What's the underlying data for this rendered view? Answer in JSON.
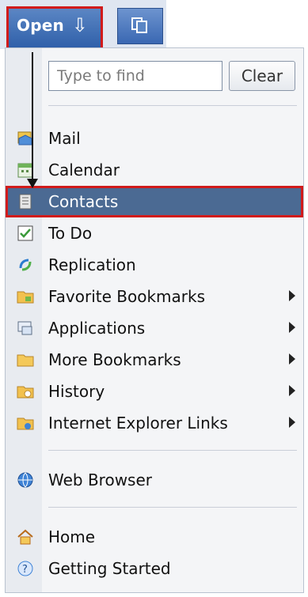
{
  "toolbar": {
    "open_label": "Open",
    "open_icon": "down-arrow-icon",
    "second_button_icon": "pages-icon"
  },
  "search": {
    "placeholder": "Type to find",
    "clear_label": "Clear"
  },
  "menu_items": [
    {
      "label": "Mail",
      "icon": "mail-icon",
      "submenu": false
    },
    {
      "label": "Calendar",
      "icon": "calendar-icon",
      "submenu": false
    },
    {
      "label": "Contacts",
      "icon": "contacts-icon",
      "submenu": false,
      "selected": true
    },
    {
      "label": "To Do",
      "icon": "todo-checkbox-icon",
      "submenu": false
    },
    {
      "label": "Replication",
      "icon": "replication-icon",
      "submenu": false
    },
    {
      "label": "Favorite Bookmarks",
      "icon": "folder-favorite-icon",
      "submenu": true
    },
    {
      "label": "Applications",
      "icon": "applications-icon",
      "submenu": true
    },
    {
      "label": "More Bookmarks",
      "icon": "folder-icon",
      "submenu": true
    },
    {
      "label": "History",
      "icon": "history-folder-icon",
      "submenu": true
    },
    {
      "label": "Internet Explorer Links",
      "icon": "ie-links-folder-icon",
      "submenu": true
    },
    {
      "label": "Web Browser",
      "icon": "globe-icon",
      "submenu": false
    },
    {
      "label": "Home",
      "icon": "home-icon",
      "submenu": false
    },
    {
      "label": "Getting Started",
      "icon": "help-icon",
      "submenu": false
    }
  ],
  "colors": {
    "selection_bg": "#4b6a93",
    "highlight_border": "#d11b1b",
    "toolbar_blue": "#2d5ea8"
  }
}
